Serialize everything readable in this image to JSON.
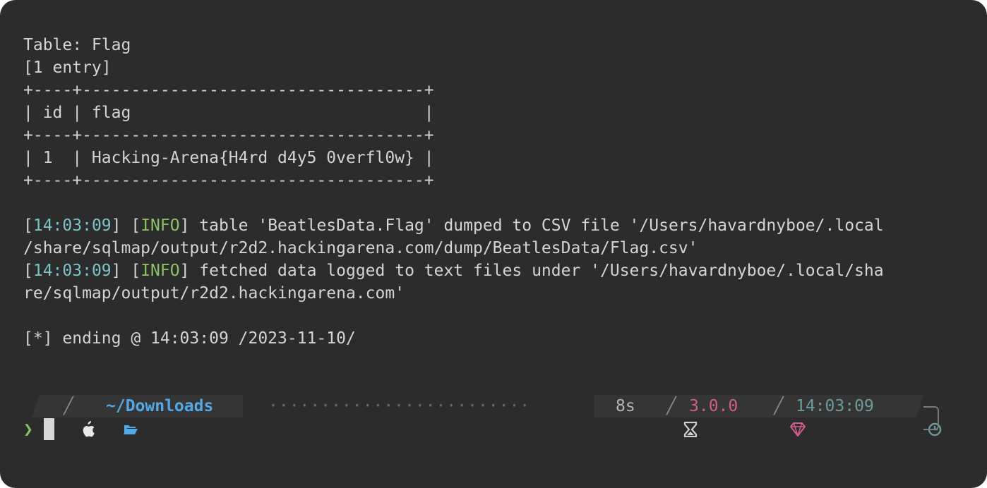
{
  "output": {
    "table_title": "Table: Flag",
    "entry_count": "[1 entry]",
    "border_line": "+----+-----------------------------------+",
    "header_row": "| id | flag                              |",
    "data_row": "| 1  | Hacking-Arena{H4rd d4y5 0verfl0w} |",
    "log1_time": "14:03:09",
    "log1_level": "INFO",
    "log1_msg_a": " table 'BeatlesData.Flag' dumped to CSV file '/Users/havardnyboe/.local",
    "log1_msg_b": "/share/sqlmap/output/r2d2.hackingarena.com/dump/BeatlesData/Flag.csv'",
    "log2_time": "14:03:09",
    "log2_level": "INFO",
    "log2_msg_a": " fetched data logged to text files under '/Users/havardnyboe/.local/sha",
    "log2_msg_b": "re/sqlmap/output/r2d2.hackingarena.com'",
    "ending": "[*] ending @ 14:03:09 /2023-11-10/"
  },
  "prompt": {
    "os_icon": "apple-icon",
    "folder_icon": "folder-icon",
    "path": "~/Downloads",
    "duration": "8s",
    "hourglass_icon": "hourglass-icon",
    "ruby_version": "3.0.0",
    "ruby_icon": "gem-icon",
    "time": "14:03:09",
    "clock_icon": "clock-icon",
    "filler": "·························",
    "input_symbol": "❯",
    "input_value": ""
  },
  "colors": {
    "background": "#2c2c2c",
    "timestamp": "#7cc5c7",
    "info": "#8ac163",
    "path": "#53a8e8",
    "ruby": "#d25c8c"
  }
}
